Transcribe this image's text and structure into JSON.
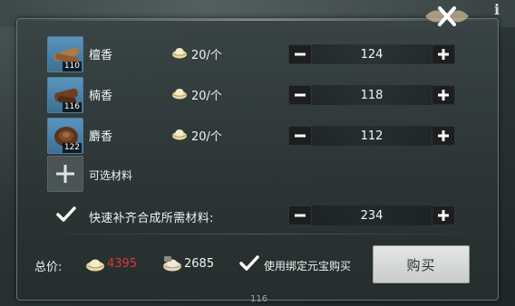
{
  "materials": [
    {
      "name": "檀香",
      "owned": "110",
      "price": "20/个",
      "quantity": "124"
    },
    {
      "name": "楠香",
      "owned": "116",
      "price": "20/个",
      "quantity": "118"
    },
    {
      "name": "麝香",
      "owned": "122",
      "price": "20/个",
      "quantity": "112"
    }
  ],
  "optional": {
    "label": "可选材料"
  },
  "fast_fill": {
    "label": "快速补齐合成所需材料:",
    "quantity": "234",
    "checked": true
  },
  "footer": {
    "total_label": "总价:",
    "total_value": "4395",
    "bound_value": "2685",
    "use_bound_label": "使用绑定元宝购买",
    "use_bound_checked": true,
    "buy_label": "购买",
    "bottom_tag": "116"
  },
  "icons": {
    "close": "close-icon",
    "info": "info-icon",
    "ingot": "yuanbao-icon",
    "bound_ingot": "bound-yuanbao-icon",
    "minus": "minus-icon",
    "plus": "plus-icon",
    "check": "check-icon"
  },
  "colors": {
    "total_value": "#e0343a",
    "buy_button": "#d8dbd9",
    "panel": "#343e3e"
  }
}
